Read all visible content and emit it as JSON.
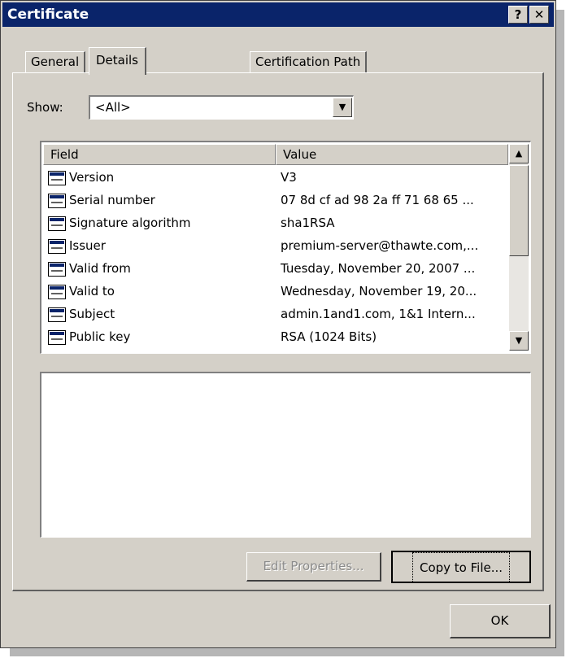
{
  "window": {
    "title": "Certificate",
    "help_glyph": "?",
    "close_glyph": "✕"
  },
  "tabs": [
    {
      "label": "General",
      "selected": false
    },
    {
      "label": "Details",
      "selected": true
    },
    {
      "label": "Certification Path",
      "selected": false
    }
  ],
  "show": {
    "label": "Show:",
    "value": "<All>"
  },
  "list": {
    "columns": [
      "Field",
      "Value"
    ],
    "rows": [
      {
        "field": "Version",
        "value": "V3"
      },
      {
        "field": "Serial number",
        "value": "07 8d cf ad 98 2a ff 71 68 65 ..."
      },
      {
        "field": "Signature algorithm",
        "value": "sha1RSA"
      },
      {
        "field": "Issuer",
        "value": "premium-server@thawte.com,..."
      },
      {
        "field": "Valid from",
        "value": "Tuesday, November 20, 2007 ..."
      },
      {
        "field": "Valid to",
        "value": "Wednesday, November 19, 20..."
      },
      {
        "field": "Subject",
        "value": "admin.1and1.com, 1&1 Intern..."
      },
      {
        "field": "Public key",
        "value": "RSA (1024 Bits)"
      }
    ]
  },
  "buttons": {
    "edit_properties": "Edit Properties...",
    "copy_to_file": "Copy to File...",
    "ok": "OK"
  },
  "colors": {
    "titlebar": "#0a246a",
    "dialog_face": "#d4d0c8"
  }
}
